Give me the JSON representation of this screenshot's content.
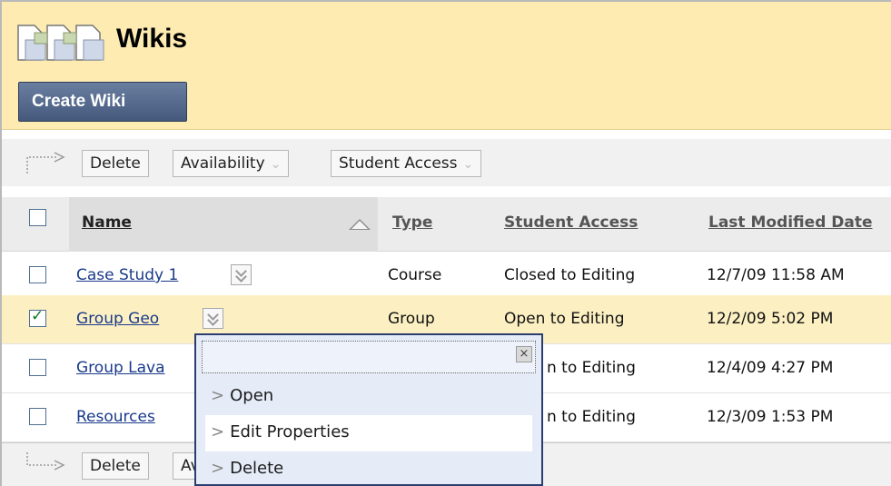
{
  "header": {
    "title": "Wikis",
    "create_label": "Create Wiki"
  },
  "actionbar_top": {
    "delete_label": "Delete",
    "availability_label": "Availability",
    "student_access_label": "Student Access"
  },
  "actionbar_bottom": {
    "delete_label": "Delete",
    "availability_label": "Av"
  },
  "table": {
    "columns": [
      "Name",
      "Type",
      "Student Access",
      "Last Modified Date"
    ],
    "rows": [
      {
        "name": "Case Study 1",
        "type": "Course",
        "access": "Closed to Editing",
        "modified": "12/7/09 11:58 AM",
        "checked": false
      },
      {
        "name": "Group Geo",
        "type": "Group",
        "access": "Open to Editing",
        "modified": "12/2/09 5:02 PM",
        "checked": true
      },
      {
        "name": "Group Lava",
        "type": "",
        "access": "n to Editing",
        "modified": "12/4/09 4:27 PM",
        "checked": false
      },
      {
        "name": "Resources",
        "type": "",
        "access": "n to Editing",
        "modified": "12/3/09 1:53 PM",
        "checked": false
      }
    ]
  },
  "context_menu": {
    "close_glyph": "×",
    "items": [
      "Open",
      "Edit Properties",
      "Delete"
    ],
    "highlighted": "Edit Properties"
  },
  "colors": {
    "header_bg": "#fdebb2",
    "button_bg": "#4d6285",
    "link": "#1a3a8a",
    "selected_row": "#fcf0c3",
    "menu_bg": "#e5ecf8"
  }
}
